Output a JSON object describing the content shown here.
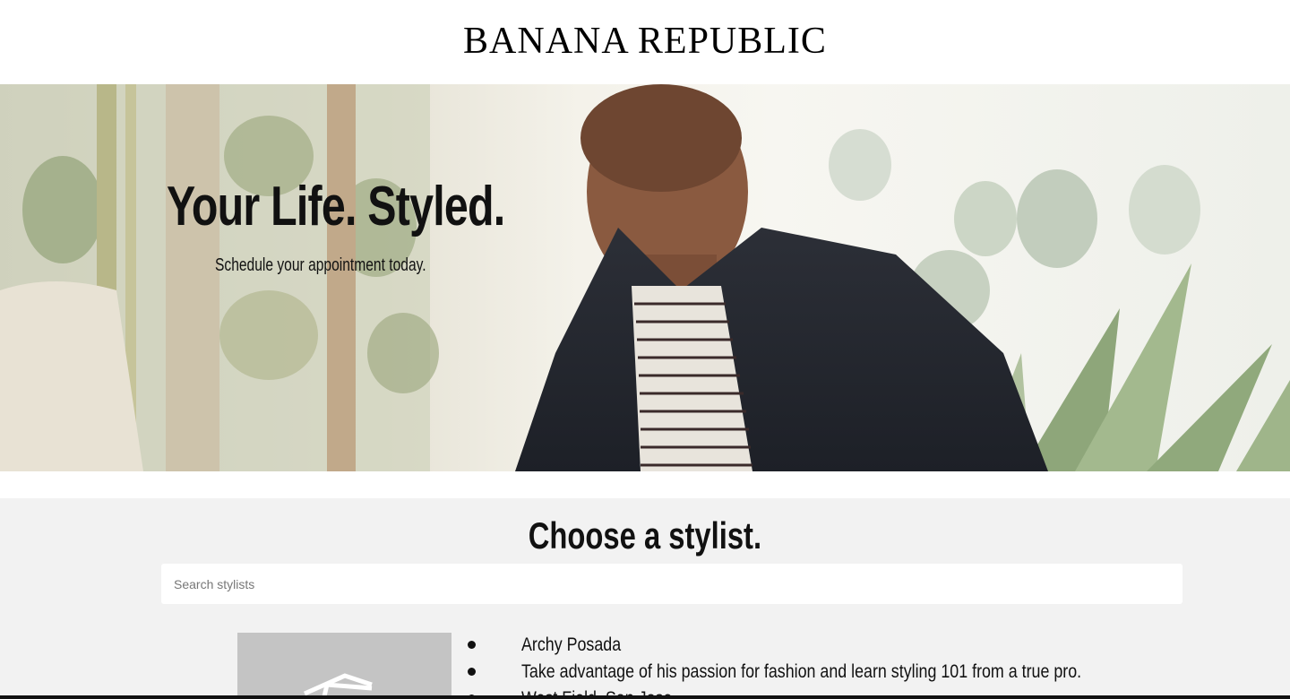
{
  "header": {
    "logo": "BANANA REPUBLIC"
  },
  "hero": {
    "title_light": "Your Life.",
    "title_bold": "Styled.",
    "subtitle": "Schedule your appointment today."
  },
  "stylists_section": {
    "title": "Choose a stylist.",
    "search_placeholder": "Search stylists",
    "stylists": [
      {
        "name": "Archy Posada",
        "bio": "Take advantage of his passion for fashion and learn styling 101 from a true pro.",
        "location": "West Field, San Jose"
      }
    ]
  },
  "colors": {
    "section_bg": "#f2f2f2",
    "photo_placeholder": "#c4c4c4",
    "text": "#111111"
  }
}
